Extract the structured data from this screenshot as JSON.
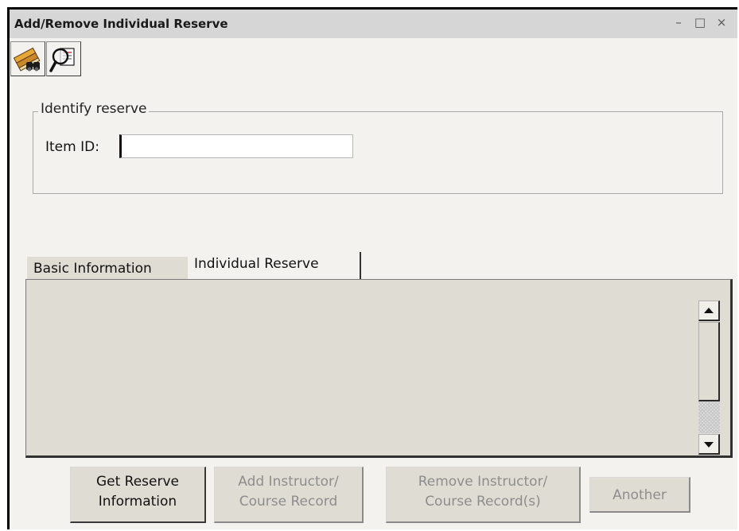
{
  "window": {
    "title": "Add/Remove Individual Reserve",
    "controls": {
      "minimize": "–",
      "maximize": "□",
      "close": "×"
    }
  },
  "toolbar": {
    "items": [
      {
        "icon": "books-binoculars-icon"
      },
      {
        "icon": "magnifier-record-icon"
      }
    ]
  },
  "identify_group": {
    "legend": "Identify reserve",
    "item_id_label": "Item ID:",
    "item_id_value": ""
  },
  "tabs": [
    {
      "label": "Basic Information",
      "active": false
    },
    {
      "label": "Individual Reserve",
      "active": true
    }
  ],
  "buttons": {
    "get_reserve": {
      "line1": "Get Reserve",
      "line2": "Information",
      "enabled": true
    },
    "add_instructor": {
      "line1": "Add Instructor/",
      "line2": "Course Record",
      "enabled": false
    },
    "remove_instructor": {
      "line1": "Remove Instructor/",
      "line2": "Course Record(s)",
      "enabled": false
    },
    "another": {
      "label": "Another",
      "enabled": false
    }
  },
  "colors": {
    "window_bg": "#f3f2ee",
    "titlebar_bg": "#d6d6d6",
    "panel_bg": "#dedcd3",
    "disabled_text": "#8d8d8d"
  }
}
